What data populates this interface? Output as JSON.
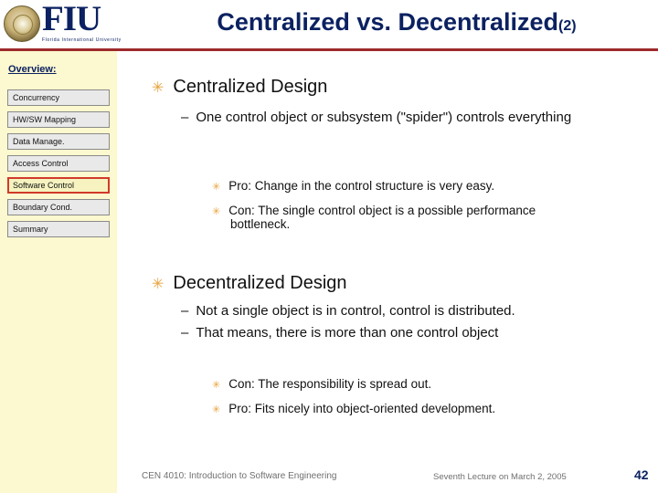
{
  "header": {
    "logo_text": "FIU",
    "logo_subtitle": "Florida International University",
    "title_main": "Centralized vs. Decentralized",
    "title_suffix": "(2)"
  },
  "sidebar": {
    "label": "Overview:",
    "items": [
      {
        "label": "Concurrency",
        "active": false
      },
      {
        "label": "HW/SW Mapping",
        "active": false
      },
      {
        "label": "Data Manage.",
        "active": false
      },
      {
        "label": "Access Control",
        "active": false
      },
      {
        "label": "Software Control",
        "active": true
      },
      {
        "label": "Boundary Cond.",
        "active": false
      },
      {
        "label": "Summary",
        "active": false
      }
    ]
  },
  "content": {
    "section1_heading": "Centralized Design",
    "section1_point1": "One control object or subsystem (\"spider\") controls everything",
    "section1_sub1": "Pro: Change in the control structure is very easy.",
    "section1_sub2": "Con: The single control object is a possible performance bottleneck.",
    "section2_heading": "Decentralized Design",
    "section2_point1": "Not a single object is in control, control is distributed.",
    "section2_point2": "That means, there is more than one control object",
    "section2_sub1": "Con: The responsibility is spread out.",
    "section2_sub2": "Pro: Fits nicely into object-oriented development.",
    "bullet_glyph": "✳",
    "dash_glyph": "–"
  },
  "footer": {
    "course": "CEN 4010: Introduction to Software Engineering",
    "lecture": "Seventh Lecture on March 2, 2005",
    "page_number": "42"
  }
}
